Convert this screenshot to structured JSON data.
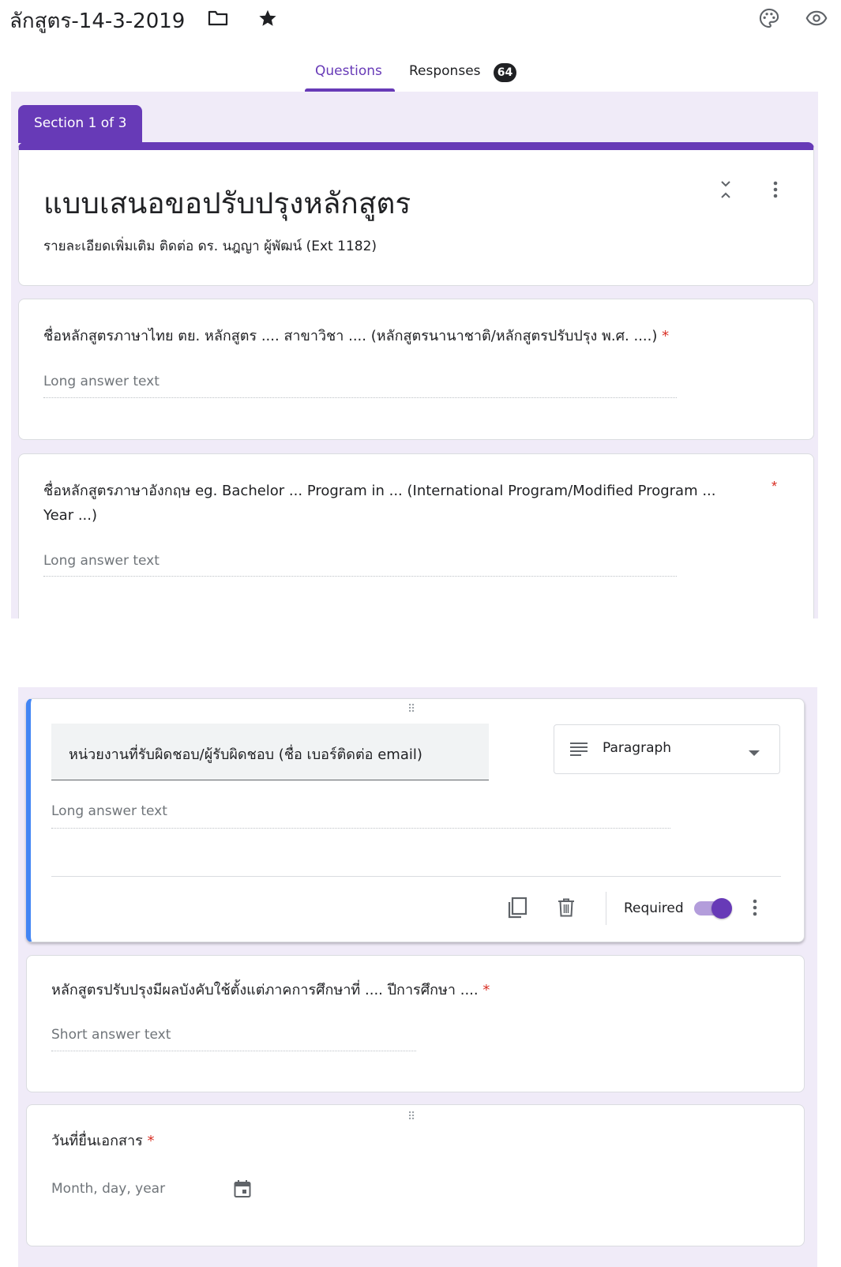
{
  "header": {
    "doc_title": "ลักสูตร-14-3-2019",
    "folder_icon": "folder-icon",
    "star_icon": "star-icon",
    "palette_icon": "palette-icon",
    "preview_icon": "eye-icon"
  },
  "tabs": {
    "questions": "Questions",
    "responses": "Responses",
    "responses_count": "64"
  },
  "section": {
    "label": "Section 1 of 3"
  },
  "form": {
    "title": "แบบเสนอขอปรับปรุงหลักสูตร",
    "description": "รายละเอียดเพิ่มเติม ติดต่อ ดร. นฎญา ผู้พัฒน์ (Ext 1182)"
  },
  "questions": [
    {
      "title": "ชื่อหลักสูตรภาษาไทย ตย. หลักสูตร .... สาขาวิชา .... (หลักสูตรนานาชาติ/หลักสูตรปรับปรุง พ.ศ. ....)",
      "required_mark": "*",
      "answer_placeholder": "Long answer text"
    },
    {
      "title_line1": "ชื่อหลักสูตรภาษาอังกฤษ eg. Bachelor ... Program in ... (International Program/Modified Program ...",
      "title_line2": "Year ...)",
      "required_mark": "*",
      "answer_placeholder": "Long answer text"
    },
    {
      "title": "หน่วยงานที่รับผิดชอบ/ผู้รับผิดชอบ (ชื่อ เบอร์ติดต่อ email)",
      "type": "Paragraph",
      "answer_placeholder": "Long answer text",
      "required_label": "Required",
      "required_on": true
    },
    {
      "title": "หลักสูตรปรับปรุงมีผลบังคับใช้ตั้งแต่ภาคการศึกษาที่ .... ปีการศึกษา ....",
      "required_mark": "*",
      "answer_placeholder": "Short answer text"
    },
    {
      "title": "วันที่ยื่นเอกสาร",
      "required_mark": "*",
      "answer_placeholder": "Month, day, year"
    }
  ],
  "colors": {
    "accent": "#673ab7",
    "active_border": "#4285f4",
    "required": "#d93025",
    "panel_bg": "#f0ebf8"
  }
}
